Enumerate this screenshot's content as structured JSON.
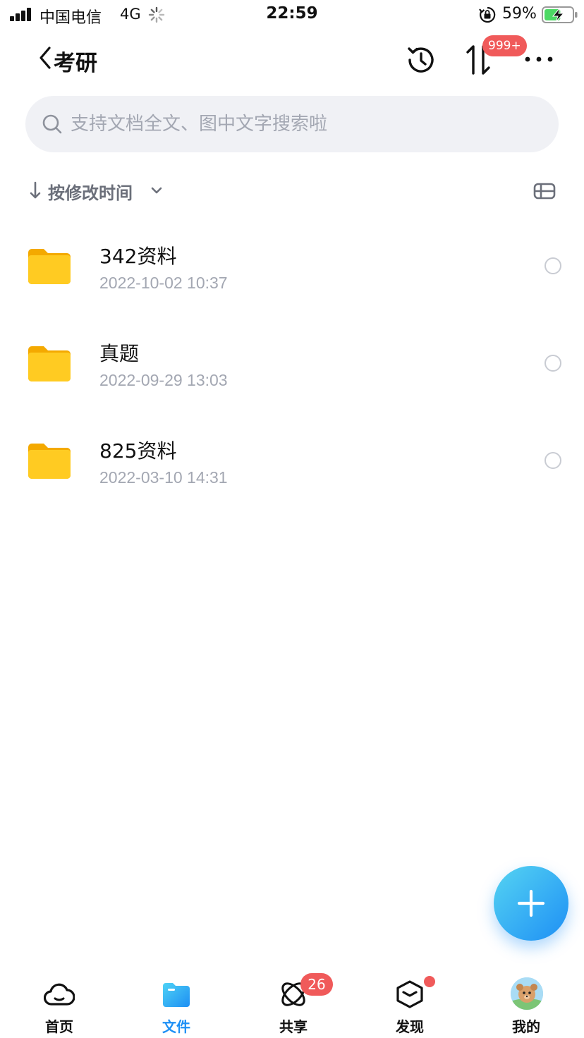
{
  "status_bar": {
    "carrier": "中国电信",
    "network": "4G",
    "time": "22:59",
    "battery_percent": "59%",
    "battery_level": 0.59
  },
  "header": {
    "title": "考研",
    "transfer_badge": "999+"
  },
  "search": {
    "placeholder": "支持文档全文、图中文字搜索啦"
  },
  "sort": {
    "label": "按修改时间"
  },
  "files": [
    {
      "name": "342资料",
      "date": "2022-10-02 10:37",
      "icon": "folder-icon"
    },
    {
      "name": "真题",
      "date": "2022-09-29 13:03",
      "icon": "folder-icon"
    },
    {
      "name": "825资料",
      "date": "2022-03-10 14:31",
      "icon": "folder-icon"
    }
  ],
  "nav": {
    "items": [
      {
        "label": "首页",
        "icon": "cloud-icon"
      },
      {
        "label": "文件",
        "icon": "folder-icon",
        "active": true
      },
      {
        "label": "共享",
        "icon": "share-icon",
        "badge": "26"
      },
      {
        "label": "发现",
        "icon": "cube-icon",
        "dot": true
      },
      {
        "label": "我的",
        "icon": "avatar"
      }
    ]
  },
  "colors": {
    "accent": "#1e90f5",
    "badge": "#f05a5a",
    "folder": "#ffc21a",
    "muted_text": "#a3a7b2"
  }
}
